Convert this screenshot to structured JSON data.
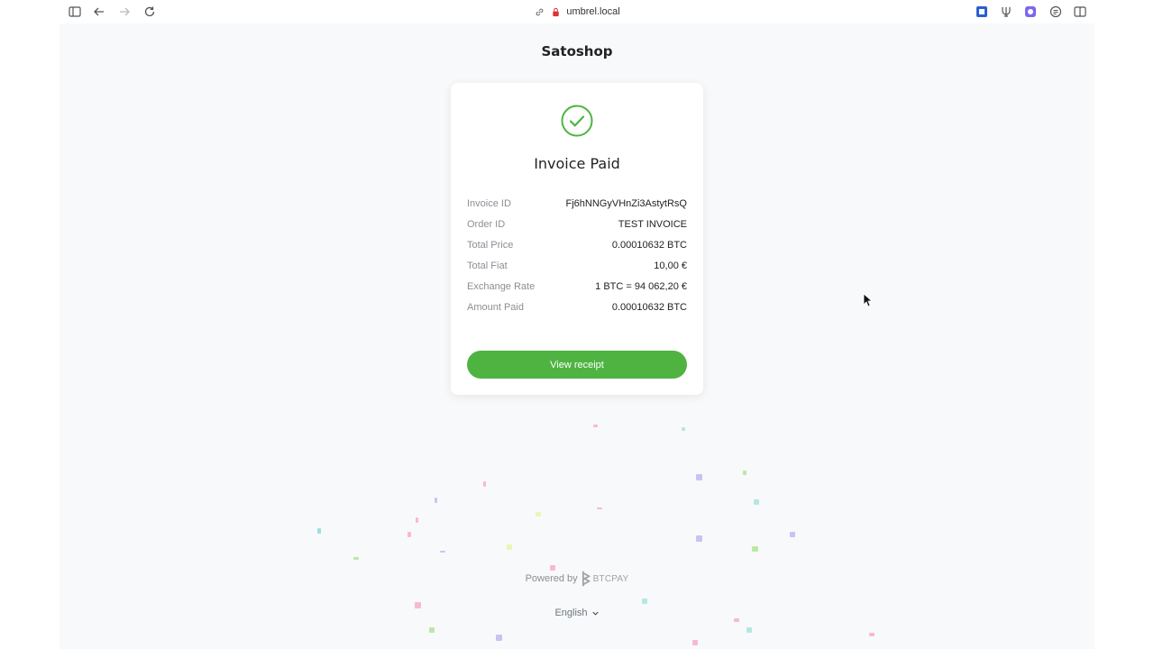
{
  "browser": {
    "url": "umbrel.local"
  },
  "page": {
    "store_title": "Satoshop",
    "status_title": "Invoice Paid",
    "details": [
      {
        "label": "Invoice ID",
        "value": "Fj6hNNGyVHnZi3AstytRsQ"
      },
      {
        "label": "Order ID",
        "value": "TEST INVOICE"
      },
      {
        "label": "Total Price",
        "value": "0.00010632 BTC"
      },
      {
        "label": "Total Fiat",
        "value": "10,00 €"
      },
      {
        "label": "Exchange Rate",
        "value": "1 BTC = 94 062,20 €"
      },
      {
        "label": "Amount Paid",
        "value": "0.00010632 BTC"
      }
    ],
    "button_label": "View receipt",
    "powered_by": "Powered by",
    "brand": "BTCPAY",
    "language": "English"
  },
  "colors": {
    "accent": "#4fb342",
    "background": "#f8f9fa"
  },
  "icons": [
    "sidebar-icon",
    "back-arrow-icon",
    "forward-arrow-icon",
    "reload-icon",
    "link-icon",
    "lock-icon",
    "extension-icon",
    "fork-icon",
    "extension-purple-icon",
    "reader-icon",
    "split-view-icon",
    "check-circle-icon",
    "chevron-down-icon",
    "btcpay-logo-icon"
  ]
}
